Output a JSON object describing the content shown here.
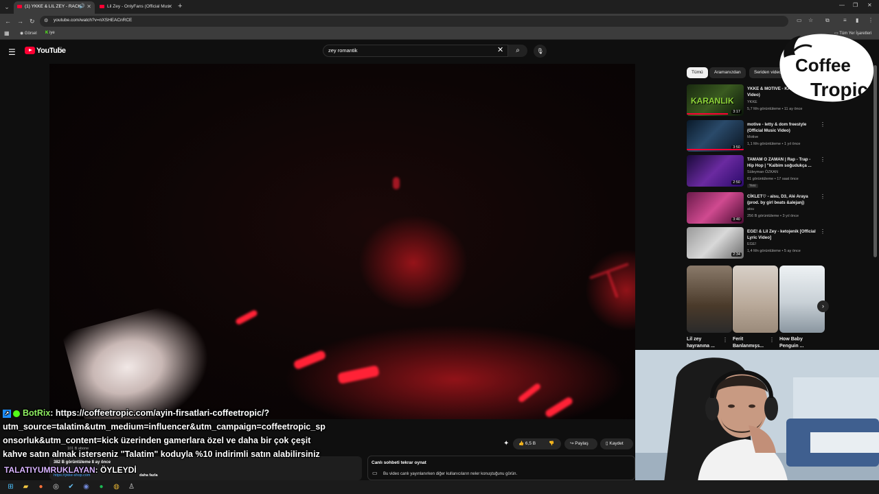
{
  "browser": {
    "tabs": [
      {
        "title": "(1) YKKE & LIL ZEY - RACK"
      },
      {
        "title": "Lil Zey - OnlyFans (Official Mus"
      }
    ],
    "url": "youtube.com/watch?v=nXSHEACnRCE",
    "bookmarks": [
      "Görsel",
      "iye"
    ],
    "all_bookmarks": "Tüm Yer İşaretleri"
  },
  "youtube": {
    "logo_text": "YouTube",
    "logo_country": "TR",
    "search_query": "zey romantik"
  },
  "sidebar": {
    "chips": [
      "Tümü",
      "Aramanızdan",
      "Seriden videolar"
    ],
    "recommendations": [
      {
        "title": "YKKE & MOTIVE - KAR (Official Video)",
        "channel": "YKKE",
        "meta": "5,7 Mn görüntüleme • 11 ay önce",
        "duration": "3:17",
        "thumb_text": "KARANLIK"
      },
      {
        "title": "motive - letty & dom freestyle (Official Music Video)",
        "channel": "Motive",
        "meta": "1,1 Mn görüntüleme • 1 yıl önce",
        "duration": "3:50"
      },
      {
        "title": "TAMAM O ZAMAN | Rap - Trap - Hip Hop | \"Kalbim soğudukça ...",
        "channel": "Süleyman ÖZKAN",
        "meta": "61 görüntüleme • 17 saat önce",
        "duration": "2:50",
        "badge": "Yeni"
      },
      {
        "title": "CİKLET♡ - aisu, D3, Alé Araya (prod. by girl beats &alejanj)",
        "channel": "aisu",
        "meta": "256 B görüntüleme • 3 yıl önce",
        "duration": "3:40"
      },
      {
        "title": "EGE! & Lil Zey - ketojenik [Official Lyric Video]",
        "channel": "EGE!",
        "meta": "1,4 Mn görüntüleme • 5 ay önce",
        "duration": "2:34"
      }
    ],
    "shorts": [
      {
        "title": "Lil zey hayranına ..."
      },
      {
        "title": "Ferit Banlanmışs..."
      },
      {
        "title": "How Baby Penguin ..."
      }
    ]
  },
  "logo": {
    "line1": "Coffee",
    "line2": "Tropic"
  },
  "actions": {
    "likes": "6,5 B",
    "share": "Paylaş",
    "save": "Kaydet"
  },
  "description": {
    "channel_subs": "101 B abone",
    "views": "382 B görüntüleme  8 ay önce",
    "link": "https://ykke-shop.com",
    "more": "daha fazla"
  },
  "chat_replay": {
    "title": "Canlı sohbeti tekrar oynat",
    "desc": "Bu video canlı yayınlanırken diğer kullanıcıların neler konuştuğunu görün."
  },
  "stream_chat": {
    "bot_name": "BotRix",
    "line1": ": https://coffeetropic.com/ayin-firsatlari-coffeetropic/?",
    "line2": "utm_source=talatim&utm_medium=influencer&utm_campaign=coffeetropic_sp",
    "line3": "onsorluk&utm_content=kick üzerinden gamerlara özel ve daha bir çok çeşit",
    "line4": "kahve satın almak isterseniz \"Talatim\" koduyla %10 indirimli satın alabilirsiniz",
    "user": "TALATIYUMRUKLAYAN",
    "message": ": ÖYLEYDİ"
  },
  "colors": {
    "yt_red": "#ff0033",
    "bot_green": "#8ff062",
    "kick_green": "#53fc18"
  }
}
